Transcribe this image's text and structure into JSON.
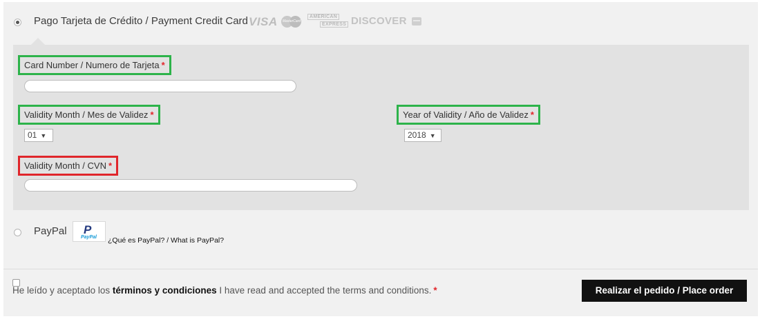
{
  "payment_methods": {
    "card": {
      "label": "Pago Tarjeta de Crédito / Payment Credit Card",
      "selected": true,
      "logos": {
        "visa": "VISA",
        "mastercard": "MasterCard",
        "amex_line1": "AMERICAN",
        "amex_line2": "EXPRESS",
        "discover": "DISCOVER"
      }
    },
    "paypal": {
      "label": "PayPal",
      "selected": false,
      "logo_text": "PayPal",
      "info_link": "¿Qué es PayPal? / What is PayPal?"
    }
  },
  "card_form": {
    "card_number": {
      "label": "Card Number / Numero de Tarjeta",
      "required_mark": "*",
      "value": "",
      "highlight": "#2db34a"
    },
    "validity_month": {
      "label": "Validity Month / Mes de Validez",
      "required_mark": "*",
      "selected": "01",
      "highlight": "#2db34a"
    },
    "validity_year": {
      "label": "Year of Validity / Año de Validez",
      "required_mark": "*",
      "selected": "2018",
      "highlight": "#2db34a"
    },
    "cvn": {
      "label": "Validity Month / CVN",
      "required_mark": "*",
      "value": "",
      "highlight": "#e0262b"
    }
  },
  "terms": {
    "checked": false,
    "text_before": "He leído y aceptado los ",
    "link_text": "términos y condiciones",
    "text_after": " I have read and accepted the terms and conditions.",
    "required_mark": "*"
  },
  "order_button": {
    "label": "Realizar el pedido / Place order"
  },
  "colors": {
    "panel_bg": "#e2e2e2",
    "page_bg": "#f1f1f1",
    "required": "#e2262b",
    "button_bg": "#111111"
  }
}
